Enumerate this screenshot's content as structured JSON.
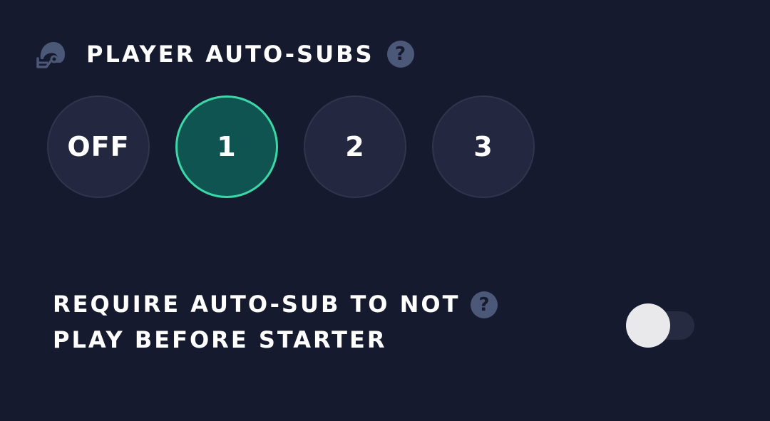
{
  "header": {
    "icon": "football-helmet-icon",
    "title": "PLAYER AUTO-SUBS",
    "help_glyph": "?"
  },
  "auto_sub_options": {
    "items": [
      {
        "label": "OFF",
        "selected": false
      },
      {
        "label": "1",
        "selected": true
      },
      {
        "label": "2",
        "selected": false
      },
      {
        "label": "3",
        "selected": false
      }
    ]
  },
  "require_setting": {
    "label_line1": "REQUIRE AUTO-SUB TO NOT",
    "label_line2": "PLAY BEFORE STARTER",
    "help_glyph": "?",
    "toggle_on": false
  },
  "colors": {
    "background": "#161a2e",
    "option_bg": "#23273f",
    "selected_bg": "#0f5450",
    "selected_border": "#3bd8a7",
    "help_bg": "#4b5878",
    "toggle_knob": "#e9e9ec",
    "toggle_track": "#262b42"
  }
}
